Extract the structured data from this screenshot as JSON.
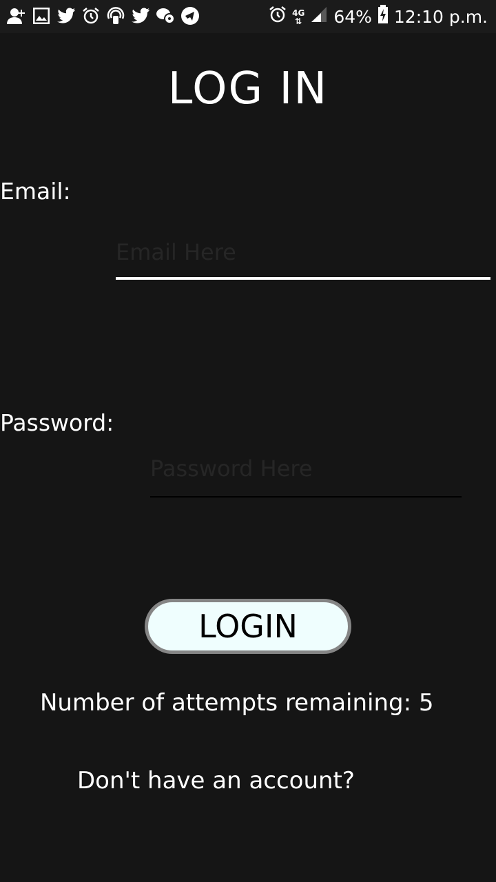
{
  "status_bar": {
    "left_icons": [
      "add-contact-icon",
      "image-icon",
      "twitter-icon",
      "alarm-icon",
      "hotspot-icon",
      "twitter-icon",
      "message-icon",
      "telegram-icon"
    ],
    "alarm_icon": "alarm-icon",
    "network": "4G",
    "battery": "64%",
    "time": "12:10 p.m."
  },
  "screen": {
    "title": "LOG IN",
    "email_label": "Email:",
    "email_placeholder": "Email Here",
    "email_value": "",
    "password_label": "Password:",
    "password_placeholder": "Password Here",
    "password_value": "",
    "login_button": "LOGIN",
    "attempts_text": "Number of attempts remaining: 5",
    "signup_text": "Don't have an account?"
  },
  "colors": {
    "background": "#151515",
    "button_fill": "#effefe",
    "button_border": "#858585",
    "text": "#ffffff"
  }
}
